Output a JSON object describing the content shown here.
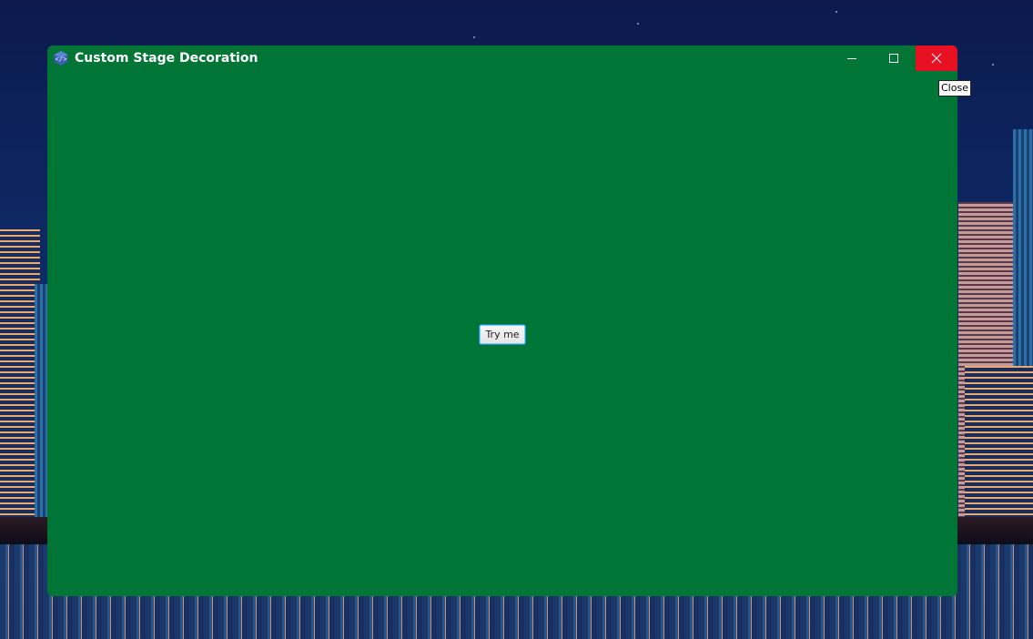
{
  "window": {
    "title": "Custom Stage Decoration",
    "background_color": "#007535",
    "controls": {
      "minimize_icon": "minimize-icon",
      "maximize_icon": "maximize-icon",
      "close_icon": "close-icon",
      "close_hover_color": "#e81123"
    }
  },
  "content": {
    "button_label": "Try me"
  },
  "tooltip": {
    "text": "Close"
  },
  "desktop": {
    "wallpaper": "night city skyline"
  }
}
